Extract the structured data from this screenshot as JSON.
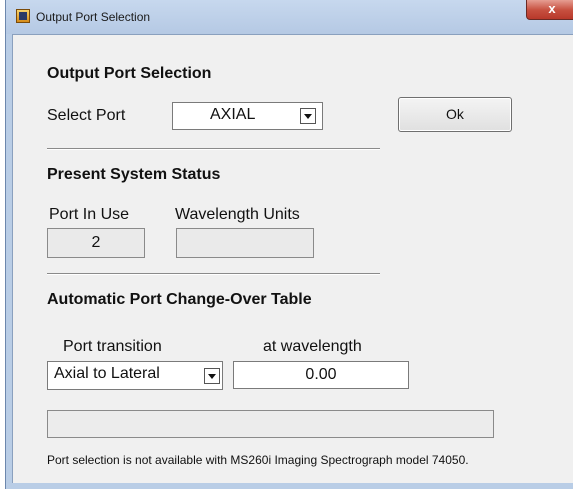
{
  "window": {
    "title": "Output Port Selection",
    "close_glyph": "x",
    "app_icon": "labview-vi-icon"
  },
  "output_port": {
    "heading": "Output Port Selection",
    "select_label": "Select Port",
    "selected_value": "AXIAL",
    "ok_label": "Ok"
  },
  "system_status": {
    "heading": "Present System Status",
    "port_in_use_label": "Port In Use",
    "port_in_use_value": "2",
    "wavelength_units_label": "Wavelength Units",
    "wavelength_units_value": ""
  },
  "changeover": {
    "heading": "Automatic Port Change-Over Table",
    "transition_label": "Port transition",
    "wavelength_label": "at wavelength",
    "transition_value": "Axial to Lateral",
    "wavelength_value": "0.00"
  },
  "status_bar_text": "",
  "note": "Port selection is not available with MS260i Imaging Spectrograph model 74050.",
  "colors": {
    "frame": "#b9cde6",
    "panel": "#f0f0f0",
    "close": "#c75040"
  }
}
